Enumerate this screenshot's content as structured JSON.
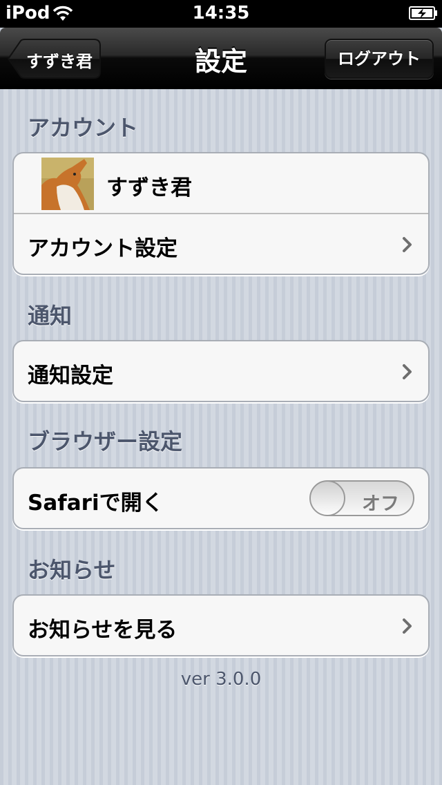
{
  "status_bar": {
    "carrier": "iPod",
    "time": "14:35"
  },
  "nav": {
    "title": "設定",
    "back_label": "すずき君",
    "logout_label": "ログアウト"
  },
  "sections": {
    "account": {
      "header": "アカウント",
      "user_name": "すずき君",
      "settings_label": "アカウント設定"
    },
    "notification": {
      "header": "通知",
      "settings_label": "通知設定"
    },
    "browser": {
      "header": "ブラウザー設定",
      "open_in_safari_label": "Safariで開く",
      "toggle_state_label": "オフ",
      "toggle_on": false
    },
    "news": {
      "header": "お知らせ",
      "view_label": "お知らせを見る"
    }
  },
  "version": "ver 3.0.0",
  "colors": {
    "section_header": "#4c566c",
    "background": "#cbd2dc"
  }
}
